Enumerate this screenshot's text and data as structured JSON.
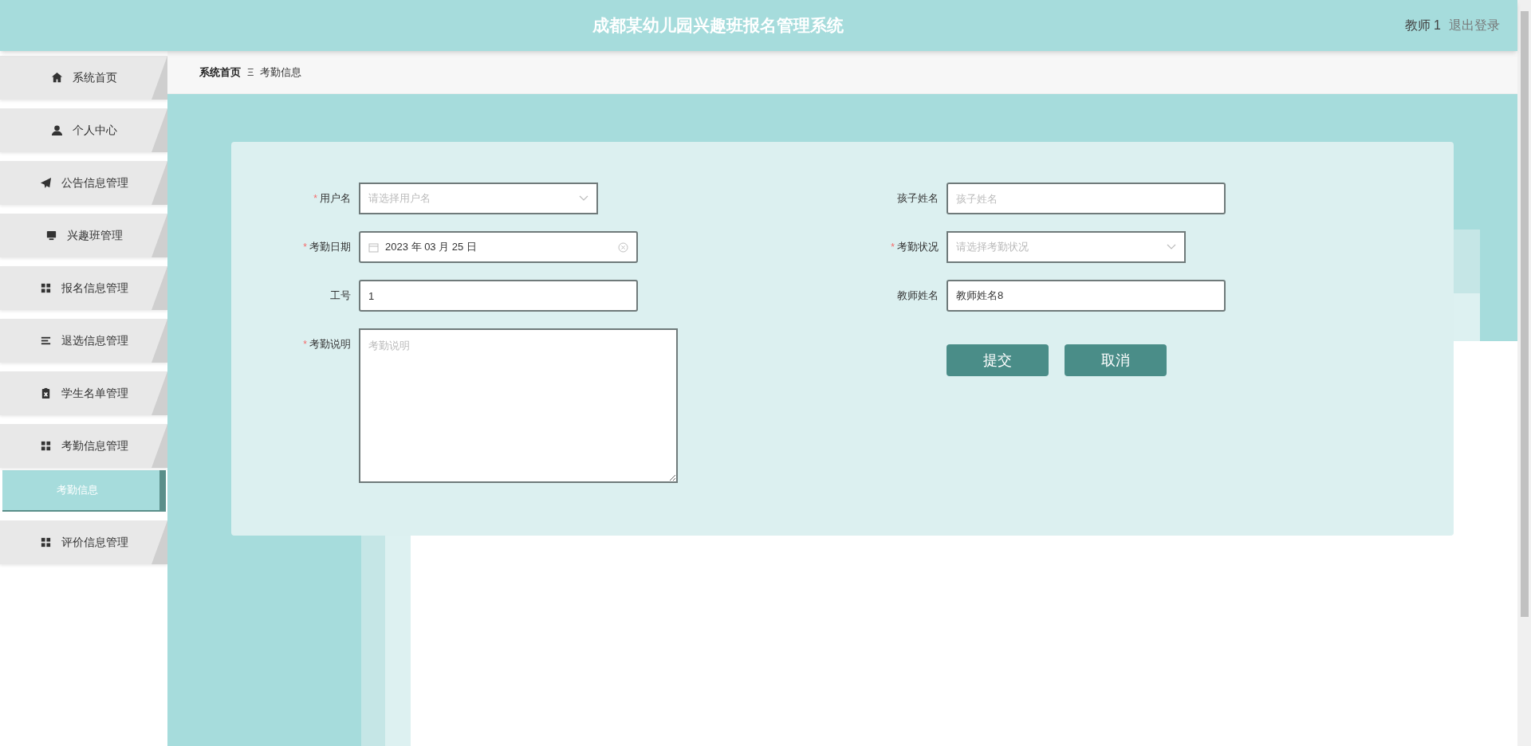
{
  "header": {
    "title": "成都某幼儿园兴趣班报名管理系统",
    "user": "教师 1",
    "logout": "退出登录"
  },
  "sidebar": {
    "items": [
      {
        "kind": "home",
        "label": "系统首页"
      },
      {
        "kind": "user",
        "label": "个人中心"
      },
      {
        "kind": "send",
        "label": "公告信息管理"
      },
      {
        "kind": "monitor",
        "label": "兴趣班管理"
      },
      {
        "kind": "grid",
        "label": "报名信息管理"
      },
      {
        "kind": "list",
        "label": "退选信息管理"
      },
      {
        "kind": "clipboard",
        "label": "学生名单管理"
      },
      {
        "kind": "grid",
        "label": "考勤信息管理",
        "children": [
          {
            "label": "考勤信息",
            "selected": true
          }
        ]
      },
      {
        "kind": "grid",
        "label": "评价信息管理"
      }
    ]
  },
  "breadcrumb": {
    "items": [
      "系统首页",
      "考勤信息"
    ],
    "separator": "Ξ"
  },
  "form": {
    "left": [
      {
        "kind": "select",
        "label": "用户名",
        "required_mark": "*",
        "placeholder": "请选择用户名"
      },
      {
        "kind": "date",
        "label": "考勤日期",
        "required_mark": "*",
        "value": "2023 年 03 月 25 日"
      },
      {
        "kind": "text",
        "label": "工号",
        "value": "1"
      },
      {
        "kind": "textarea",
        "label": "考勤说明",
        "required_mark": "*",
        "placeholder": "考勤说明"
      }
    ],
    "right": [
      {
        "kind": "text",
        "label": "孩子姓名",
        "placeholder": "孩子姓名"
      },
      {
        "kind": "select",
        "label": "考勤状况",
        "required_mark": "*",
        "placeholder": "请选择考勤状况"
      },
      {
        "kind": "text",
        "label": "教师姓名",
        "value": "教师姓名8"
      }
    ],
    "buttons": [
      "提交",
      "取消"
    ]
  }
}
